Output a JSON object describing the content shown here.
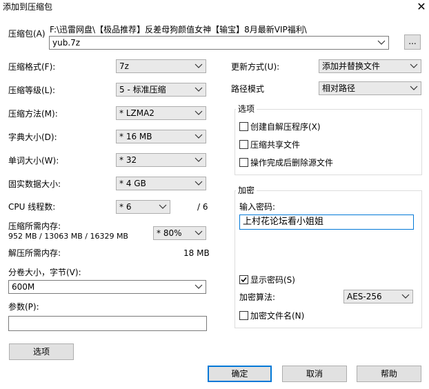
{
  "window": {
    "title": "添加到压缩包",
    "close_glyph": "✕"
  },
  "archive": {
    "label": "压缩包(A)",
    "path": "F:\\迅雷网盘\\【极品推荐】反差母狗颜值女神【输宝】8月最新VIP福利\\",
    "filename": "yub.7z",
    "browse_label": "..."
  },
  "left": {
    "format": {
      "label": "压缩格式(F):",
      "value": "7z"
    },
    "level": {
      "label": "压缩等级(L):",
      "value": "5 - 标准压缩"
    },
    "method": {
      "label": "压缩方法(M):",
      "value": "* LZMA2"
    },
    "dict": {
      "label": "字典大小(D):",
      "value": "* 16 MB"
    },
    "word": {
      "label": "单词大小(W):",
      "value": "* 32"
    },
    "solid": {
      "label": "固实数据大小:",
      "value": "* 4 GB"
    },
    "cpu": {
      "label": "CPU 线程数:",
      "value": "* 6",
      "total": "/ 6"
    },
    "mem_comp": {
      "label": "压缩所需内存:",
      "detail": "952 MB / 13063 MB / 16329 MB",
      "value": "* 80%"
    },
    "mem_decomp": {
      "label": "解压所需内存:",
      "value": "18 MB"
    },
    "volume": {
      "label": "分卷大小，字节(V):",
      "value": "600M"
    },
    "params": {
      "label": "参数(P):",
      "value": ""
    },
    "options_button": "选项"
  },
  "right": {
    "update": {
      "label": "更新方式(U):",
      "value": "添加并替换文件"
    },
    "pathmode": {
      "label": "路径模式",
      "value": "相对路径"
    },
    "options": {
      "title": "选项",
      "sfx": {
        "label": "创建自解压程序(X)",
        "checked": false
      },
      "shared": {
        "label": "压缩共享文件",
        "checked": false
      },
      "delete": {
        "label": "操作完成后删除源文件",
        "checked": false
      }
    },
    "encryption": {
      "title": "加密",
      "password_label": "输入密码:",
      "password": "上村花论坛看小姐姐",
      "show": {
        "label": "显示密码(S)",
        "checked": true
      },
      "algo_label": "加密算法:",
      "algo": "AES-256",
      "encrypt_names": {
        "label": "加密文件名(N)",
        "checked": false
      }
    }
  },
  "footer": {
    "ok": "确定",
    "cancel": "取消",
    "help": "帮助"
  },
  "colors": {
    "accent": "#0078d7",
    "button_bg": "#e1e1e1",
    "combo_bg": "#e9e9e9"
  }
}
